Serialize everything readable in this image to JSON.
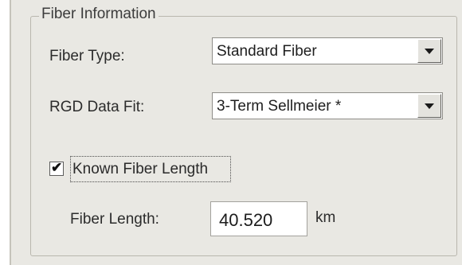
{
  "group": {
    "title": "Fiber Information"
  },
  "fiber_type": {
    "label": "Fiber Type:",
    "value": "Standard Fiber"
  },
  "rgd_fit": {
    "label": "RGD Data Fit:",
    "value": "3-Term Sellmeier *"
  },
  "known_length": {
    "label": "Known Fiber Length",
    "checked": true,
    "check_glyph": "✔"
  },
  "fiber_length": {
    "label": "Fiber Length:",
    "value": "40.520",
    "unit": "km"
  }
}
